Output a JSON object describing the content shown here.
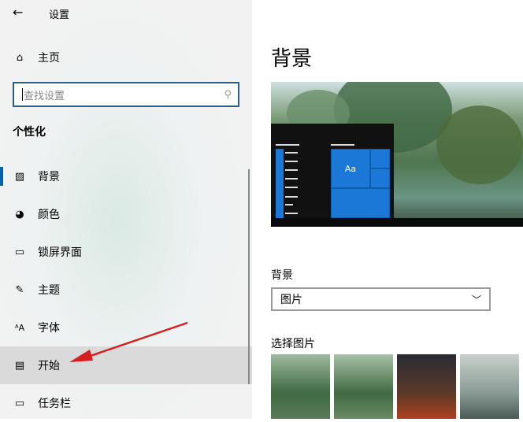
{
  "window": {
    "title": "设置"
  },
  "sidebar": {
    "home": "主页",
    "search_placeholder": "查找设置",
    "section": "个性化",
    "items": [
      {
        "label": "背景",
        "icon": "picture-icon"
      },
      {
        "label": "颜色",
        "icon": "palette-icon"
      },
      {
        "label": "锁屏界面",
        "icon": "lock-screen-icon"
      },
      {
        "label": "主题",
        "icon": "theme-icon"
      },
      {
        "label": "字体",
        "icon": "font-icon"
      },
      {
        "label": "开始",
        "icon": "start-icon"
      },
      {
        "label": "任务栏",
        "icon": "taskbar-icon"
      }
    ]
  },
  "main": {
    "title": "背景",
    "preview_tile_text": "Aa",
    "background_label": "背景",
    "background_value": "图片",
    "choose_picture_label": "选择图片"
  },
  "colors": {
    "accent": "#0078d7",
    "annotation_arrow": "#d42020"
  }
}
